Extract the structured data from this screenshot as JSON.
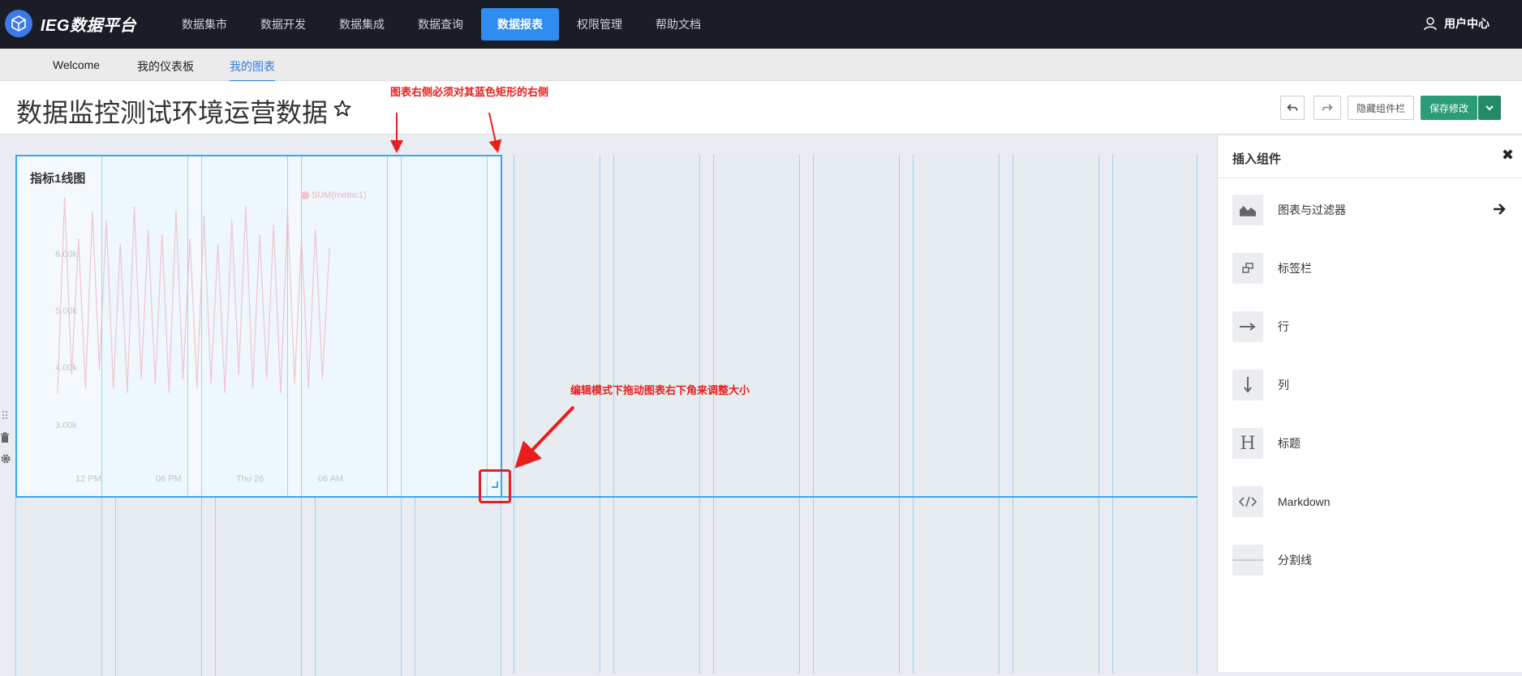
{
  "app": {
    "logo_text": "IEG数据平台",
    "nav": [
      "数据集市",
      "数据开发",
      "数据集成",
      "数据查询",
      "数据报表",
      "权限管理",
      "帮助文档"
    ],
    "active_nav": "数据报表",
    "user_label": "用户中心"
  },
  "subnav": {
    "tabs": [
      "Welcome",
      "我的仪表板",
      "我的图表"
    ],
    "active": "我的图表"
  },
  "dashboard": {
    "title": "数据监控测试环境运营数据",
    "toolbar": {
      "undo_label": "undo",
      "redo_label": "redo",
      "hide_panel_label": "隐藏组件栏",
      "save_label": "保存修改"
    }
  },
  "widget": {
    "title": "指标1线图",
    "legend": "SUM(metric1)",
    "y_ticks": [
      "6.00k",
      "5.00k",
      "4.00k",
      "3.00k"
    ],
    "x_ticks": [
      "12 PM",
      "06 PM",
      "Thu 26",
      "06 AM"
    ]
  },
  "chart_data": {
    "type": "line",
    "title": "指标1线图",
    "series": [
      {
        "name": "SUM(metric1)",
        "values": [
          2600,
          6800,
          3000,
          5900,
          2700,
          6500,
          3100,
          6300,
          2700,
          5800,
          2600,
          6600,
          2900,
          6100,
          2800,
          6000,
          2600,
          6500,
          2900,
          5900,
          2700,
          6400,
          2800,
          5800,
          2600,
          6300,
          3000,
          6600,
          2700,
          6000,
          2900,
          6200,
          2600,
          6500,
          2800,
          5900,
          2700,
          6100,
          2900,
          5700
        ]
      }
    ],
    "x_ticks": [
      "12 PM",
      "06 PM",
      "Thu 26",
      "06 AM"
    ],
    "ylim": [
      2000,
      7000
    ],
    "grid": false,
    "legend_position": "top"
  },
  "annotations": {
    "right_edge": "图表右侧必须对其蓝色矩形的右侧",
    "resize": "编辑模式下拖动图表右下角来调整大小"
  },
  "panel": {
    "title": "插入组件",
    "items": [
      {
        "label": "图表与过滤器",
        "icon": "area-chart-icon"
      },
      {
        "label": "标签栏",
        "icon": "tabs-icon"
      },
      {
        "label": "行",
        "icon": "arrow-right-icon"
      },
      {
        "label": "列",
        "icon": "arrow-down-icon"
      },
      {
        "label": "标题",
        "icon": "heading-icon"
      },
      {
        "label": "Markdown",
        "icon": "code-icon"
      },
      {
        "label": "分割线",
        "icon": "divider-icon"
      }
    ]
  },
  "colors": {
    "topbar": "#1a1d26",
    "nav_active": "#2f8cf0",
    "save": "#2a9d78",
    "grid_blue": "#3aa5ee",
    "annotation_red": "#e81d1d",
    "series": "#f0b8c2"
  }
}
